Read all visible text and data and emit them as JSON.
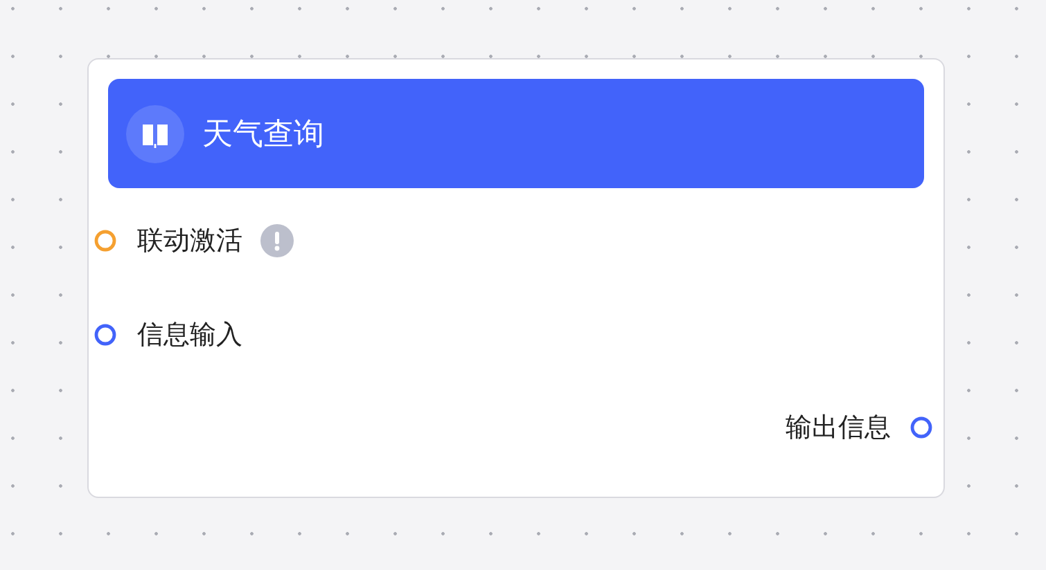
{
  "node": {
    "title": "天气查询",
    "inputs": [
      {
        "label": "联动激活",
        "color": "#f5a030",
        "warning": true
      },
      {
        "label": "信息输入",
        "color": "#4263fa",
        "warning": false
      }
    ],
    "outputs": [
      {
        "label": "输出信息",
        "color": "#4263fa"
      }
    ]
  }
}
